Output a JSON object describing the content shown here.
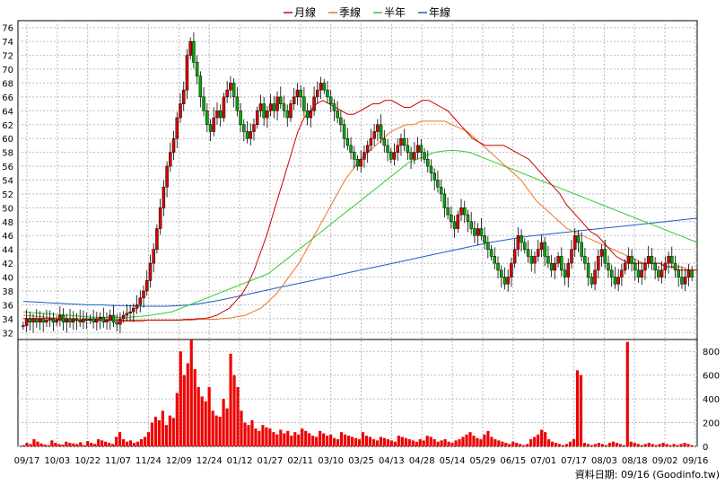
{
  "chart_data": {
    "type": "candlestick",
    "legend": [
      {
        "name": "月線",
        "color": "#cc0000"
      },
      {
        "name": "季線",
        "color": "#e87722"
      },
      {
        "name": "半年",
        "color": "#33cc33"
      },
      {
        "name": "年線",
        "color": "#1a5fc7"
      }
    ],
    "price_axis": {
      "min": 31,
      "max": 77,
      "ticks": [
        32,
        34,
        36,
        38,
        40,
        42,
        44,
        46,
        48,
        50,
        52,
        54,
        56,
        58,
        60,
        62,
        64,
        66,
        68,
        70,
        72,
        74,
        76
      ]
    },
    "volume_axis": {
      "min": 0,
      "max": 900,
      "ticks": [
        0,
        200,
        400,
        600,
        800
      ]
    },
    "x_labels": [
      "09/17",
      "10/03",
      "10/22",
      "11/07",
      "11/24",
      "12/09",
      "12/24",
      "01/12",
      "01/27",
      "02/11",
      "03/10",
      "03/25",
      "04/13",
      "04/28",
      "05/14",
      "05/29",
      "06/15",
      "07/01",
      "07/17",
      "08/03",
      "08/18",
      "09/02",
      "09/16"
    ],
    "close_series": [
      33,
      34,
      33.5,
      34,
      33.5,
      34,
      33.5,
      33.8,
      34,
      33.5,
      33.8,
      34.5,
      33.5,
      34,
      33.5,
      34,
      33.8,
      33.5,
      34,
      33.8,
      34,
      33.5,
      34,
      34.2,
      33.5,
      33.8,
      34.5,
      33.5,
      33.2,
      34,
      34.5,
      34.8,
      35,
      35.5,
      36,
      37,
      38,
      39.5,
      42,
      44,
      47,
      50,
      53,
      56,
      58,
      60,
      63,
      65,
      67,
      72,
      74,
      71,
      69,
      66,
      64,
      62,
      61,
      63,
      64,
      63,
      66,
      67,
      68,
      66,
      64,
      62,
      61,
      60,
      61,
      62,
      64,
      65,
      63,
      64,
      65,
      64,
      66,
      65,
      64,
      63,
      65,
      66,
      67,
      66,
      64,
      63,
      64,
      66,
      67,
      68,
      67,
      66,
      65,
      64,
      63,
      62,
      60,
      59,
      58,
      57,
      56,
      57,
      58,
      59,
      60,
      61,
      62,
      60,
      59,
      58,
      57,
      58,
      59,
      60,
      59,
      58,
      57,
      58,
      59,
      58,
      57,
      56,
      55,
      54,
      53,
      52,
      50,
      49,
      48,
      47,
      49,
      50,
      49,
      48,
      47,
      46,
      47,
      46,
      45,
      44,
      43,
      42,
      41,
      40,
      39,
      40,
      42,
      44,
      46,
      45,
      44,
      43,
      42,
      43,
      44,
      45,
      43,
      42,
      41,
      42,
      43,
      41,
      40,
      42,
      44,
      46,
      45,
      43,
      42,
      40,
      39,
      41,
      43,
      44,
      42,
      41,
      40,
      39,
      40,
      41,
      42,
      43,
      42,
      41,
      40,
      41,
      42,
      43,
      42,
      41,
      40,
      41,
      42,
      43,
      42,
      41,
      40,
      39,
      40,
      41,
      40
    ],
    "volume_series": [
      10,
      30,
      20,
      60,
      40,
      25,
      15,
      10,
      50,
      30,
      20,
      15,
      40,
      30,
      25,
      20,
      35,
      10,
      45,
      30,
      20,
      60,
      50,
      40,
      30,
      20,
      80,
      120,
      60,
      40,
      50,
      30,
      40,
      60,
      80,
      120,
      200,
      250,
      220,
      300,
      180,
      260,
      240,
      450,
      800,
      600,
      700,
      900,
      650,
      500,
      420,
      380,
      500,
      300,
      260,
      250,
      400,
      320,
      780,
      600,
      500,
      300,
      200,
      180,
      220,
      150,
      130,
      180,
      160,
      150,
      120,
      100,
      140,
      110,
      130,
      90,
      120,
      100,
      150,
      130,
      110,
      90,
      80,
      130,
      110,
      90,
      100,
      70,
      60,
      120,
      100,
      90,
      80,
      70,
      60,
      120,
      90,
      80,
      60,
      50,
      80,
      70,
      60,
      50,
      40,
      90,
      80,
      70,
      60,
      50,
      40,
      60,
      50,
      90,
      80,
      60,
      40,
      50,
      60,
      40,
      30,
      50,
      60,
      80,
      100,
      120,
      90,
      70,
      60,
      100,
      130,
      80,
      60,
      50,
      40,
      30,
      20,
      40,
      30,
      20,
      10,
      20,
      60,
      80,
      100,
      140,
      120,
      60,
      40,
      30,
      20,
      10,
      20,
      40,
      60,
      640,
      600,
      30,
      20,
      10,
      20,
      30,
      20,
      10,
      30,
      40,
      30,
      20,
      10,
      880,
      40,
      30,
      20,
      10,
      20,
      30,
      20,
      10,
      20,
      30,
      20,
      10,
      20,
      10,
      20,
      30,
      20,
      10
    ],
    "ma_month": [
      34,
      34,
      34,
      34,
      34,
      34,
      33.8,
      33.8,
      33.8,
      33.8,
      33.8,
      33.8,
      33.8,
      33.8,
      33.8,
      33.8,
      33.7,
      33.7,
      33.7,
      33.7,
      33.8,
      33.8,
      33.8,
      33.8,
      33.8,
      33.8,
      33.9,
      33.9,
      34,
      34,
      34.2,
      34.5,
      35,
      35.5,
      36.5,
      37.5,
      39,
      41,
      43.5,
      46,
      49,
      52,
      55,
      58,
      61,
      63,
      64,
      65,
      65.5,
      65,
      64.5,
      64,
      63.5,
      63.5,
      64,
      64.5,
      65,
      65,
      65.5,
      65.5,
      65,
      64.5,
      64.5,
      65,
      65.5,
      65.5,
      65,
      64.5,
      64,
      63,
      62,
      61,
      60,
      59.5,
      59,
      59,
      59,
      59,
      58.5,
      58,
      57.5,
      57,
      56,
      55,
      54,
      53,
      52,
      50.5,
      49.5,
      48.5,
      47.5,
      46.5,
      46,
      45,
      44,
      43,
      42.5,
      42,
      42,
      42,
      42,
      42,
      42,
      41.5,
      41.5,
      41,
      41,
      41,
      41
    ],
    "ma_quarter": [
      34.5,
      34.4,
      34.3,
      34.2,
      34.1,
      34,
      34,
      34,
      33.9,
      33.9,
      33.9,
      33.9,
      33.8,
      33.8,
      33.8,
      33.8,
      33.8,
      33.8,
      33.8,
      33.8,
      33.8,
      33.8,
      33.8,
      33.9,
      33.9,
      33.9,
      34,
      34.1,
      34.3,
      34.5,
      35,
      35.5,
      36.5,
      37.5,
      39,
      40.5,
      42,
      44,
      46,
      48,
      50,
      52,
      54,
      55.5,
      57,
      58,
      59,
      60,
      61,
      61.5,
      62,
      62,
      62.5,
      62.5,
      62.5,
      62.5,
      62,
      61.5,
      61,
      60,
      59,
      58,
      57,
      56,
      55,
      54,
      52.5,
      51,
      50,
      49,
      48,
      47,
      46.5,
      46,
      45.5,
      45,
      44.5,
      44,
      43.5,
      43,
      42.5,
      42,
      42,
      42,
      41.5,
      41.5,
      41.5,
      41,
      41
    ],
    "ma_half": [
      35,
      34.9,
      34.8,
      34.7,
      34.6,
      34.5,
      34.4,
      34.3,
      34.2,
      34.2,
      34.2,
      34.2,
      34.2,
      34.3,
      34.4,
      34.6,
      34.8,
      35,
      35.5,
      36,
      36.5,
      37,
      37.5,
      38,
      38.5,
      39,
      39.5,
      40,
      40.5,
      41.5,
      42.5,
      43.5,
      44.5,
      45.5,
      46.5,
      47.5,
      48.5,
      49.5,
      50.5,
      51.5,
      52.5,
      53.5,
      54.5,
      55.5,
      56.5,
      57,
      57.5,
      58,
      58.2,
      58.3,
      58.2,
      58,
      57.5,
      57,
      56.5,
      56,
      55.5,
      55,
      54.5,
      54,
      53.5,
      53,
      52.5,
      52,
      51.5,
      51,
      50.5,
      50,
      49.5,
      49,
      48.5,
      48,
      47.5,
      47,
      46.5,
      46,
      45.5,
      45
    ],
    "ma_year": [
      36.5,
      36.4,
      36.3,
      36.2,
      36.1,
      36,
      36,
      35.9,
      35.9,
      35.8,
      35.8,
      35.8,
      35.9,
      36,
      36.3,
      36.6,
      37,
      37.4,
      37.8,
      38.2,
      38.6,
      39,
      39.4,
      39.8,
      40.2,
      40.6,
      41,
      41.4,
      41.8,
      42.2,
      42.6,
      43,
      43.4,
      43.8,
      44.2,
      44.6,
      45,
      45.3,
      45.6,
      45.9,
      46.1,
      46.3,
      46.5,
      46.7,
      46.9,
      47.1,
      47.3,
      47.5,
      47.7,
      47.9,
      48.1,
      48.3,
      48.5
    ],
    "footer": "資料日期: 09/16  (Goodinfo.tw)"
  }
}
